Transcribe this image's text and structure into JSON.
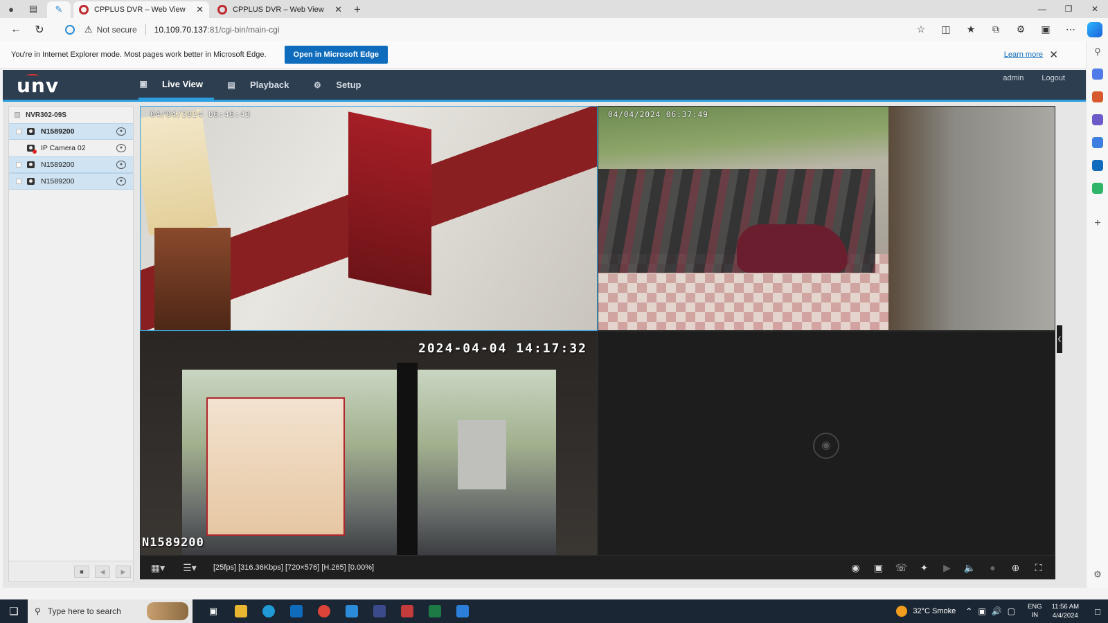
{
  "browser": {
    "tabs": [
      {
        "title": "CPPLUS DVR – Web View"
      },
      {
        "title": "CPPLUS DVR – Web View"
      }
    ],
    "security_label": "Not secure",
    "url_host": "10.109.70.137",
    "url_path": ":81/cgi-bin/main-cgi",
    "ie_bar": {
      "message": "You're in Internet Explorer mode. Most pages work better in Microsoft Edge.",
      "open_button": "Open in Microsoft Edge",
      "learn_more": "Learn more"
    }
  },
  "app": {
    "logo": "unv",
    "nav": [
      {
        "label": "Live View",
        "icon": "monitor-icon"
      },
      {
        "label": "Playback",
        "icon": "film-icon"
      },
      {
        "label": "Setup",
        "icon": "gear-icon"
      }
    ],
    "user": "admin",
    "logout": "Logout",
    "tree": {
      "root": "NVR302-09S",
      "items": [
        {
          "label": "N1589200",
          "selected": true,
          "error": false
        },
        {
          "label": "IP Camera 02",
          "selected": false,
          "error": true
        },
        {
          "label": "N1589200",
          "selected": false,
          "error": false
        },
        {
          "label": "N1589200",
          "selected": false,
          "error": false
        }
      ]
    },
    "panes": [
      {
        "osd_time": "04/04/2024 06:46:43"
      },
      {
        "osd_time": "04/04/2024 06:37:49"
      },
      {
        "osd_time": "2024-04-04 14:17:32",
        "osd_name": "N1589200"
      },
      {
        "empty": true
      }
    ],
    "stream_stats": "[25fps] [316.36Kbps] [720×576] [H.265] [0.00%]"
  },
  "taskbar": {
    "search_placeholder": "Type here to search",
    "weather": "32°C  Smoke",
    "lang_line1": "ENG",
    "lang_line2": "IN",
    "time": "11:56 AM",
    "date": "4/4/2024"
  }
}
